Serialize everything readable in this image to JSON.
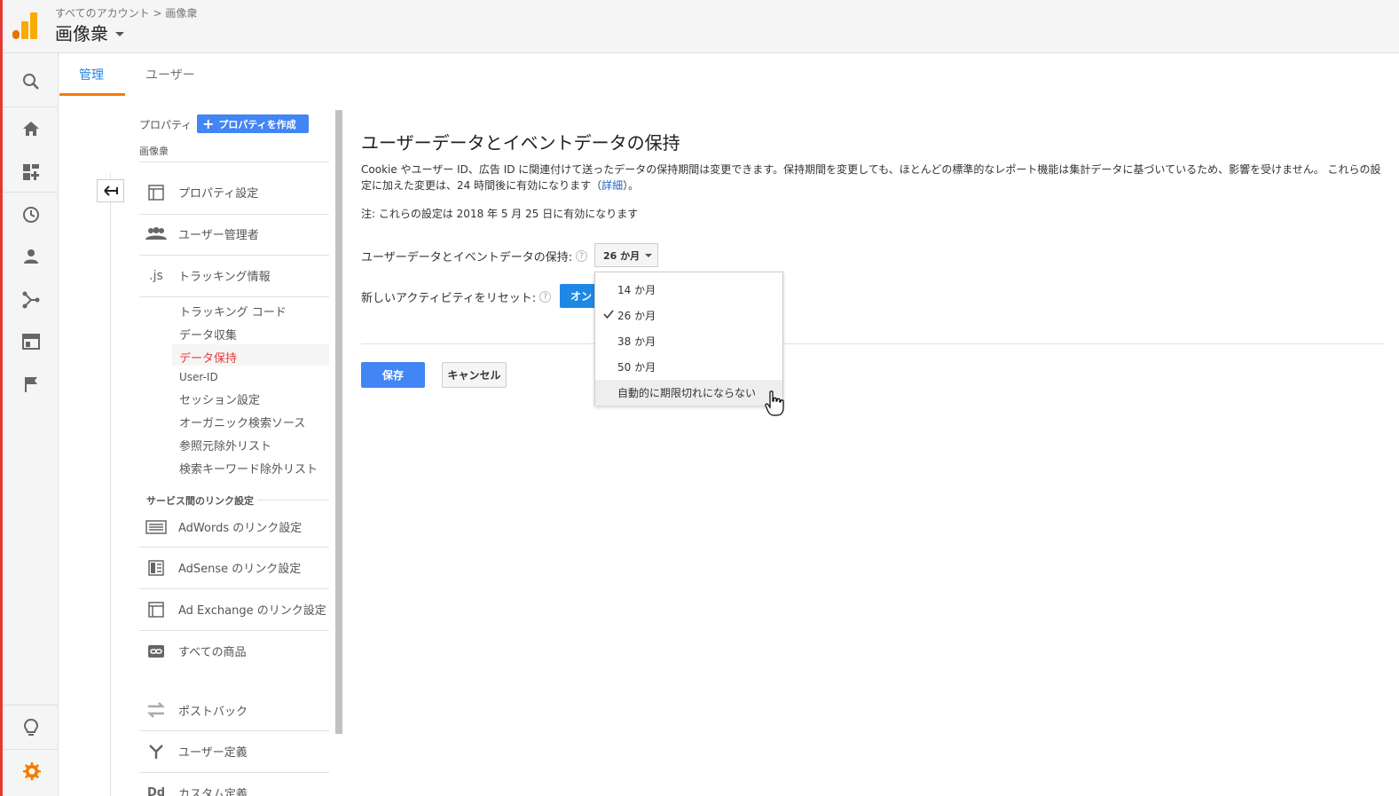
{
  "header": {
    "breadcrumb": "すべてのアカウント > 画像衆",
    "account_name": "画像衆"
  },
  "rail": {
    "icons": [
      "search-icon",
      "home-icon",
      "dashboard-icon",
      "clock-icon",
      "person-icon",
      "acquisition-icon",
      "behavior-icon",
      "flag-icon",
      "lightbulb-icon",
      "gear-icon"
    ]
  },
  "tabs": {
    "admin": "管理",
    "user": "ユーザー"
  },
  "nav": {
    "property_label": "プロパティ",
    "create_property": "プロパティを作成",
    "property_name": "画像衆",
    "items": {
      "property_settings": "プロパティ設定",
      "user_management": "ユーザー管理者",
      "tracking_info": "トラッキング情報",
      "js_glyph": ".js"
    },
    "tracking_sub": [
      "トラッキング コード",
      "データ収集",
      "データ保持",
      "User-ID",
      "セッション設定",
      "オーガニック検索ソース",
      "参照元除外リスト",
      "検索キーワード除外リスト"
    ],
    "section_product_linking": "サービス間のリンク設定",
    "linking": {
      "adwords": "AdWords のリンク設定",
      "adsense": "AdSense のリンク設定",
      "adexchange": "Ad Exchange のリンク設定",
      "all_products": "すべての商品"
    },
    "postback": "ポストバック",
    "user_definitions": "ユーザー定義",
    "custom_definitions": "カスタム定義"
  },
  "main": {
    "title": "ユーザーデータとイベントデータの保持",
    "description": "Cookie やユーザー ID、広告 ID に関連付けて送ったデータの保持期間は変更できます。保持期間を変更しても、ほとんどの標準的なレポート機能は集計データに基づいているため、影響を受けません。 これらの設定に加えた変更は、24 時間後に有効になります（",
    "description_link": "詳細",
    "description_end": "）。",
    "note": "注: これらの設定は 2018 年 5 月 25 日に有効になります",
    "retention_label": "ユーザーデータとイベントデータの保持:",
    "retention_value": "26 か月",
    "reset_label": "新しいアクティビティをリセット:",
    "reset_value": "オン",
    "help_glyph": "?",
    "save": "保存",
    "cancel": "キャンセル"
  },
  "menu": {
    "options": [
      "14 か月",
      "26 か月",
      "38 か月",
      "50 か月",
      "自動的に期限切れにならない"
    ],
    "selected": "26 か月",
    "hovered": "自動的に期限切れにならない"
  },
  "colors": {
    "accent_blue": "#4285f4",
    "active_red": "#e53935",
    "tab_orange": "#f57c00",
    "logo_orange": "#f9ab00"
  }
}
